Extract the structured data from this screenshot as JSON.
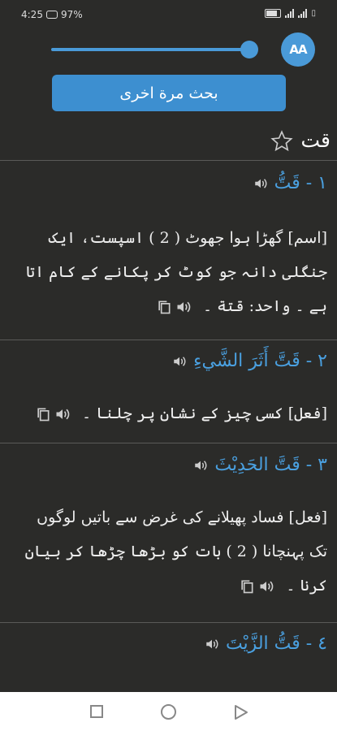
{
  "status_bar": {
    "time": "4:25",
    "battery": "97%"
  },
  "toolbar": {
    "font_size_button": "AA",
    "slider_level": 0.95,
    "search_again_label": "بحث مرة اخرى"
  },
  "word": {
    "title": "قت"
  },
  "entries": [
    {
      "heading": "١ - قَتُّ",
      "text": "[اسم] گھڑا ہوا جھوٹ ( 2 ) اسپست، ایک جنگلی دانہ جو کوٹ کر پکانے کے کام اتا ہے ۔ واحد: قتة ۔"
    },
    {
      "heading": "٢ - قَتَّ أَثَرَ الشَّيءِ",
      "text": "[فعل] کسی چیز کے نشان پر چلنا ۔"
    },
    {
      "heading": "٣ - قَتَّ الحَدِيْثَ",
      "text": "[فعل] فساد پھیلانے کی غرض سے باتیں لوگوں تک پہنچانا ( 2 ) بات کو بڑھا چڑھا کر بیان کرنا ۔"
    },
    {
      "heading": "٤ - قَتُّ الزَّيْتَ",
      "text": ""
    }
  ],
  "icons": {
    "speaker": "speaker-icon",
    "copy": "copy-icon",
    "star": "star-outline-icon"
  },
  "colors": {
    "accent": "#4a9ad8",
    "heading": "#4aa0e0",
    "background": "#2b2b29"
  }
}
